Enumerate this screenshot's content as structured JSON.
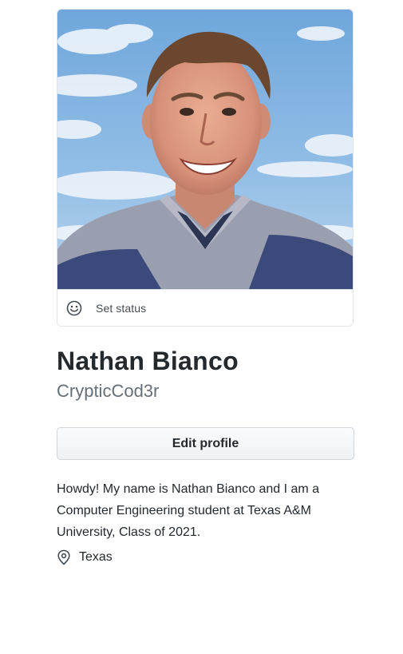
{
  "profile": {
    "status_label": "Set status",
    "full_name": "Nathan Bianco",
    "username": "CrypticCod3r",
    "edit_button_label": "Edit profile",
    "bio": "Howdy! My name is Nathan Bianco and I am a Computer Engineering student at Texas A&M University, Class of 2021.",
    "location": "Texas"
  },
  "icons": {
    "status": "smiley-icon",
    "location": "location-pin-icon"
  },
  "colors": {
    "text_primary": "#24292e",
    "text_muted": "#666e76",
    "border": "#e1e4e8",
    "sky": "#7fb0de"
  }
}
